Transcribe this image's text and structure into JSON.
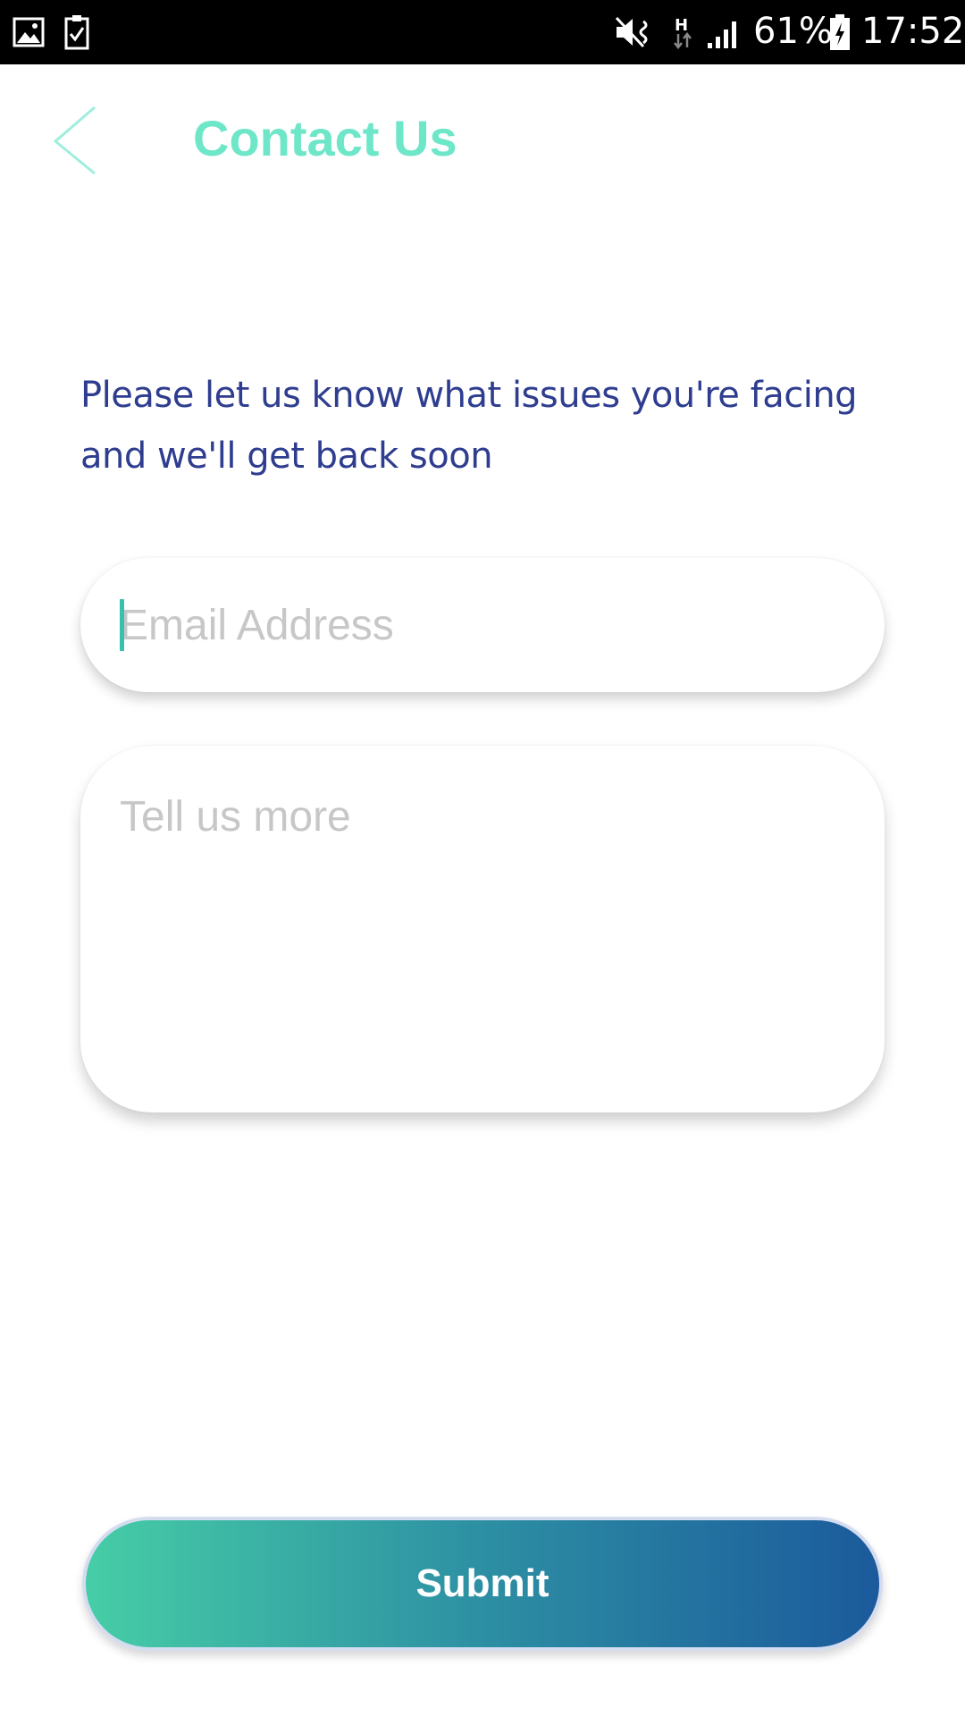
{
  "colors": {
    "accent": "#6ee6c8",
    "intro_text": "#2e3d8f",
    "button_gradient_start": "#46cda6",
    "button_gradient_end": "#1b5a9c",
    "status_bar_bg": "#000000"
  },
  "status_bar": {
    "left_icons": [
      "gallery-icon",
      "checklist-icon"
    ],
    "right_icons": [
      "mute-vibrate-icon",
      "data-h-icon",
      "signal-icon",
      "battery-charging-icon"
    ],
    "battery_percent": "61%",
    "time": "17:52"
  },
  "header": {
    "back_icon": "chevron-left-icon",
    "title": "Contact Us"
  },
  "intro": {
    "line1": "Please let us know what issues you're facing",
    "line2": "and we'll get back soon"
  },
  "form": {
    "email": {
      "placeholder": "Email Address",
      "value": ""
    },
    "message": {
      "placeholder": "Tell us more",
      "value": ""
    },
    "submit_label": "Submit"
  }
}
